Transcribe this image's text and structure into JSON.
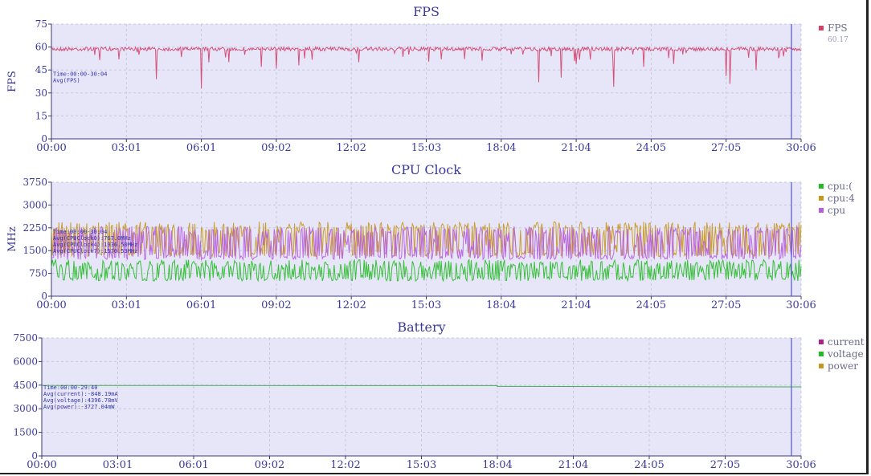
{
  "chart_data": [
    {
      "type": "line",
      "title": "FPS",
      "ylabel": "FPS",
      "ylim": [
        0,
        75
      ],
      "yticks": [
        "0",
        "15",
        "30",
        "45",
        "60",
        "75"
      ],
      "xticks": [
        "00:00",
        "03:01",
        "06:01",
        "09:02",
        "12:02",
        "15:03",
        "18:04",
        "21:04",
        "24:05",
        "27:05",
        "30:06"
      ],
      "legend": [
        {
          "name": "FPS",
          "value": "60.17",
          "color": "#d4406a"
        }
      ],
      "annotation": [
        "Time:00:00-30:04",
        "Avg(FPS)"
      ],
      "series": [
        {
          "name": "FPS",
          "color": "#d4406a",
          "baseline": 60,
          "dips": [
            [
              0.09,
              52
            ],
            [
              0.14,
              39
            ],
            [
              0.2,
              33
            ],
            [
              0.21,
              50
            ],
            [
              0.28,
              47
            ],
            [
              0.3,
              46
            ],
            [
              0.33,
              48
            ],
            [
              0.52,
              52
            ],
            [
              0.65,
              37
            ],
            [
              0.68,
              40
            ],
            [
              0.7,
              49
            ],
            [
              0.75,
              34
            ],
            [
              0.79,
              47
            ],
            [
              0.83,
              49
            ],
            [
              0.9,
              41
            ],
            [
              0.905,
              36
            ],
            [
              0.94,
              45
            ]
          ]
        }
      ]
    },
    {
      "type": "line",
      "title": "CPU Clock",
      "ylabel": "MHz",
      "ylim": [
        0,
        3750
      ],
      "yticks": [
        "0",
        "750",
        "1500",
        "2250",
        "3000",
        "3750"
      ],
      "xticks": [
        "00:00",
        "03:01",
        "06:01",
        "09:02",
        "12:02",
        "15:03",
        "18:04",
        "21:04",
        "24:05",
        "27:05",
        "30:06"
      ],
      "legend": [
        {
          "name": "cpu:(",
          "color": "#22bb22"
        },
        {
          "name": "cpu:4",
          "color": "#c8961e"
        },
        {
          "name": "cpu",
          "color": "#b65ce0"
        }
      ],
      "annotation": [
        "Time:00:00-30:04",
        "Avg(CPUClock0):767.0MHz",
        "Avg(CPUClock4):1936.50MHz",
        "Avg(CPUClock7):1570.53MHz"
      ],
      "series": [
        {
          "name": "cpu:0",
          "color": "#22bb22",
          "low": 500,
          "high": 1200
        },
        {
          "name": "cpu:4",
          "color": "#c8961e",
          "low": 1300,
          "high": 2450
        },
        {
          "name": "cpu:7",
          "color": "#b65ce0",
          "low": 1200,
          "high": 2300
        }
      ]
    },
    {
      "type": "line",
      "title": "Battery",
      "ylabel": "",
      "ylim": [
        0,
        7500
      ],
      "yticks": [
        "0",
        "1500",
        "3000",
        "4500",
        "6000",
        "7500"
      ],
      "xticks": [
        "00:00",
        "03:01",
        "06:01",
        "09:02",
        "12:02",
        "15:03",
        "18:04",
        "21:04",
        "24:05",
        "27:05",
        "30:06"
      ],
      "legend": [
        {
          "name": "current",
          "color": "#b0208c"
        },
        {
          "name": "voltage",
          "color": "#22bb22"
        },
        {
          "name": "power",
          "color": "#c8961e"
        }
      ],
      "annotation": [
        "Time:00:00-29:40",
        "Avg(current):-848.19mA",
        "Avg(voltage):4396.78mV",
        "Avg(power):-3727.04mW"
      ],
      "series": [
        {
          "name": "voltage",
          "color": "#33aa44",
          "points": [
            [
              0,
              4480
            ],
            [
              0.6,
              4470
            ],
            [
              0.6,
              4420
            ],
            [
              1,
              4390
            ]
          ]
        }
      ]
    }
  ]
}
